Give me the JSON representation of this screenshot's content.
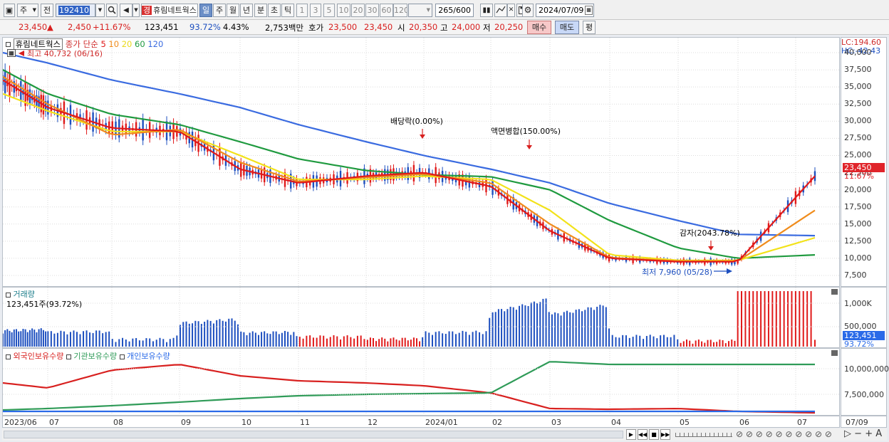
{
  "toolbar": {
    "market": "주",
    "prev": "전",
    "code": "192410",
    "stock_name": "휴림네트웍스",
    "grade_badge": "경",
    "periods": [
      "일",
      "주",
      "월",
      "년",
      "분",
      "초",
      "틱"
    ],
    "minutes": [
      "1",
      "3",
      "5",
      "10",
      "20",
      "30",
      "60",
      "120"
    ],
    "count_label": "265",
    "count_max": "/600",
    "date": "2024/07/09"
  },
  "quote": {
    "price": "23,450",
    "arrow": "▲",
    "change": "2,450",
    "change_pct": "+11.67%",
    "volume": "123,451",
    "vol_pct": "93.72%",
    "turnover_pct": "4.43%",
    "amount": "2,753백만",
    "ask_label": "호가",
    "ask1": "23,500",
    "ask2": "23,450",
    "open_label": "시",
    "open": "20,350",
    "high_label": "고",
    "high": "24,000",
    "low_label": "저",
    "low": "20,250",
    "buy": "매수",
    "sell": "매도",
    "eval": "평"
  },
  "price_panel": {
    "legend": {
      "name": "휴림네트웍스",
      "text": "종가 단순",
      "ma": [
        "5",
        "10",
        "20",
        "60",
        "120"
      ]
    },
    "max_label": "최고 40,732 (06/16)",
    "min_label": "최저 7,960 (05/28)",
    "events": [
      "배당락(0.00%)",
      "액면병합(150.00%)",
      "감자(2043.78%)"
    ],
    "lc": "LC:194.60",
    "hc": "HC:-42.43",
    "yticks": [
      "40,000",
      "37,500",
      "35,000",
      "32,500",
      "30,000",
      "27,500",
      "25,000",
      "22,500",
      "20,000",
      "17,500",
      "15,000",
      "12,500",
      "10,000",
      "7,500"
    ],
    "price_tag": "23,450",
    "pct_tag": "11.67%"
  },
  "volume_panel": {
    "title": "거래량",
    "info": "123,451주(93.72%)",
    "yticks": [
      "1,000K",
      "500,000"
    ],
    "tag": "123,451",
    "tag_pct": "93.72%"
  },
  "holding_panel": {
    "series": [
      "외국인보유수량",
      "기관보유수량",
      "개인보유수량"
    ],
    "yticks": [
      "10,000,000",
      "7,500,000"
    ]
  },
  "xaxis": {
    "labels": [
      "2023/06",
      "07",
      "08",
      "09",
      "10",
      "11",
      "12",
      "2024/01",
      "02",
      "03",
      "04",
      "05",
      "06",
      "07"
    ],
    "right_label": "07/09"
  },
  "colors": {
    "ma5": "#e01a1a",
    "ma10": "#f08c1c",
    "ma20": "#f2e21a",
    "ma60": "#1f9a3f",
    "ma120": "#3a6be0",
    "foreign": "#d8201f",
    "inst": "#2f9b58",
    "retail": "#2a6ae8"
  },
  "chart_data": {
    "type": "line",
    "title": "휴림네트웍스 종가 단순",
    "x": [
      "2023/06",
      "07",
      "08",
      "09",
      "10",
      "11",
      "12",
      "2024/01",
      "02",
      "03",
      "04",
      "05",
      "06",
      "07"
    ],
    "series": [
      {
        "name": "5",
        "values": [
          36000,
          32000,
          29000,
          28500,
          23000,
          21000,
          22000,
          22500,
          20500,
          14000,
          10000,
          9500,
          9500,
          22000
        ]
      },
      {
        "name": "10",
        "values": [
          36500,
          32500,
          28000,
          28800,
          24000,
          21200,
          21800,
          22300,
          21000,
          15000,
          10100,
          9600,
          9600,
          17000
        ]
      },
      {
        "name": "20",
        "values": [
          34000,
          31500,
          28500,
          28500,
          25000,
          21500,
          21500,
          22000,
          21500,
          17000,
          10500,
          9700,
          9700,
          13000
        ]
      },
      {
        "name": "60",
        "values": [
          37500,
          34000,
          31000,
          29500,
          27000,
          24500,
          22800,
          22200,
          21900,
          20000,
          15500,
          11500,
          10000,
          10500
        ]
      },
      {
        "name": "120",
        "values": [
          40000,
          38500,
          36000,
          34000,
          32000,
          29500,
          27000,
          25000,
          23000,
          21000,
          18000,
          15500,
          13500,
          13300
        ]
      }
    ],
    "ylim": [
      7500,
      40000
    ]
  }
}
